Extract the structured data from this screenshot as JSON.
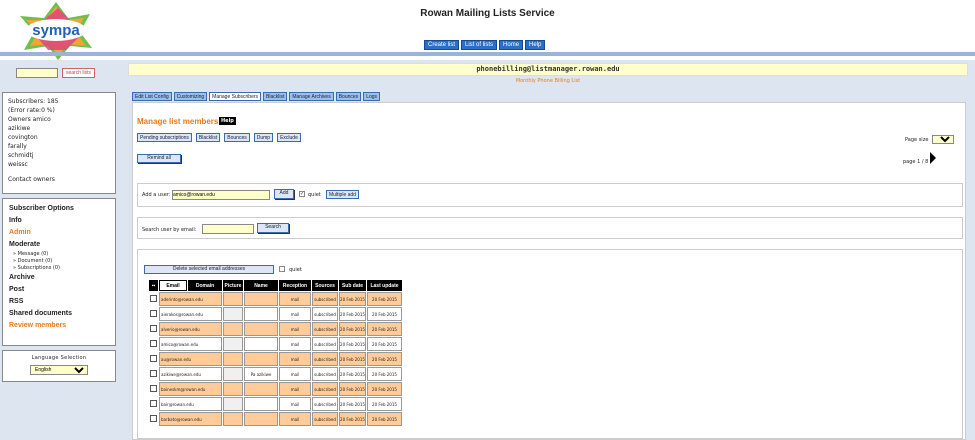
{
  "header": {
    "site_title": "Rowan Mailing Lists Service",
    "logo_text": "sympa",
    "nav": [
      {
        "label": "Create list"
      },
      {
        "label": "List of lists"
      },
      {
        "label": "Home"
      },
      {
        "label": "Help"
      }
    ]
  },
  "sidebar": {
    "search_button": "search lists",
    "info": {
      "subscribers": "Subscribers: 185",
      "error_rate": "(Error rate:0 %)",
      "owners_label": "Owners amico",
      "owners": [
        "azikiwe",
        "covington",
        "farally",
        "schmidtj",
        "weissc"
      ],
      "contact_owners": "Contact owners"
    },
    "menu": {
      "subscriber_options": "Subscriber Options",
      "info": "Info",
      "admin": "Admin",
      "moderate": "Moderate",
      "moderate_sub": [
        "» Message (0)",
        "» Document (0)",
        "» Subscriptions (0)"
      ],
      "archive": "Archive",
      "post": "Post",
      "rss": "RSS",
      "shared_documents": "Shared documents",
      "review_members": "Review members"
    },
    "language": {
      "title": "Language Selection",
      "selected": "English"
    }
  },
  "main": {
    "list_address": "phonebilling@listmanager.rowan.edu",
    "list_subtitle": "Monthly Phone Billing List",
    "tabs": [
      {
        "label": "Edit List Config",
        "active": false
      },
      {
        "label": "Customizing",
        "active": false
      },
      {
        "label": "Manage Subscribers",
        "active": true
      },
      {
        "label": "Blacklist",
        "active": false
      },
      {
        "label": "Manage Archives",
        "active": false
      },
      {
        "label": "Bounces",
        "active": false
      },
      {
        "label": "Logs",
        "active": false
      }
    ],
    "title": "Manage list members",
    "help_label": "Help",
    "action_buttons": [
      "Pending subscriptions",
      "Blacklist",
      "Bounces",
      "Dump",
      "Exclude"
    ],
    "remind_all": "Remind all",
    "page_size_label": "Page size",
    "page_size_value": "25",
    "page_info": "page 1 / 8",
    "add_user": {
      "label": "Add a user:",
      "value": "amico@rowan.edu",
      "add_button": "Add",
      "quiet_label": "quiet",
      "quiet_checked": true,
      "multiple_add": "Multiple add"
    },
    "search_user": {
      "label": "Search user by email:",
      "button": "Search",
      "value": ""
    },
    "delete_button": "Delete selected email addresses",
    "delete_quiet_label": "quiet",
    "table": {
      "headers": [
        "",
        "Email",
        "Domain",
        "Picture",
        "Name",
        "Reception",
        "Sources",
        "Sub date",
        "Last update"
      ],
      "rows": [
        {
          "email": "aderinto@rowan.edu",
          "name": "",
          "reception": "mail",
          "sources": "subscribed",
          "sub_date": "20 Feb 2015",
          "last_update": "20 Feb 2015"
        },
        {
          "email": "aierakos@rowan.edu",
          "name": "",
          "reception": "mail",
          "sources": "subscribed",
          "sub_date": "20 Feb 2015",
          "last_update": "20 Feb 2015"
        },
        {
          "email": "alverio@rowan.edu",
          "name": "",
          "reception": "mail",
          "sources": "subscribed",
          "sub_date": "20 Feb 2015",
          "last_update": "20 Feb 2015"
        },
        {
          "email": "amico@rowan.edu",
          "name": "",
          "reception": "mail",
          "sources": "subscribed",
          "sub_date": "20 Feb 2015",
          "last_update": "20 Feb 2015"
        },
        {
          "email": "au@rowan.edu",
          "name": "",
          "reception": "mail",
          "sources": "subscribed",
          "sub_date": "20 Feb 2015",
          "last_update": "20 Feb 2015"
        },
        {
          "email": "azikiwe@rowan.edu",
          "name": "Pa azikiwe",
          "reception": "mail",
          "sources": "subscribed",
          "sub_date": "20 Feb 2015",
          "last_update": "20 Feb 2015"
        },
        {
          "email": "baineskm@rowan.edu",
          "name": "",
          "reception": "mail",
          "sources": "subscribed",
          "sub_date": "20 Feb 2015",
          "last_update": "20 Feb 2015"
        },
        {
          "email": "bair@rowan.edu",
          "name": "",
          "reception": "mail",
          "sources": "subscribed",
          "sub_date": "20 Feb 2015",
          "last_update": "20 Feb 2015"
        },
        {
          "email": "barbato@rowan.edu",
          "name": "",
          "reception": "mail",
          "sources": "subscribed",
          "sub_date": "20 Feb 2015",
          "last_update": "20 Feb 2015"
        }
      ]
    }
  },
  "colors": {
    "accent": "#e87b1e",
    "nav_blue": "#2a6ec8",
    "row_highlight": "#ffcc99",
    "input_bg": "#ffffcc"
  }
}
